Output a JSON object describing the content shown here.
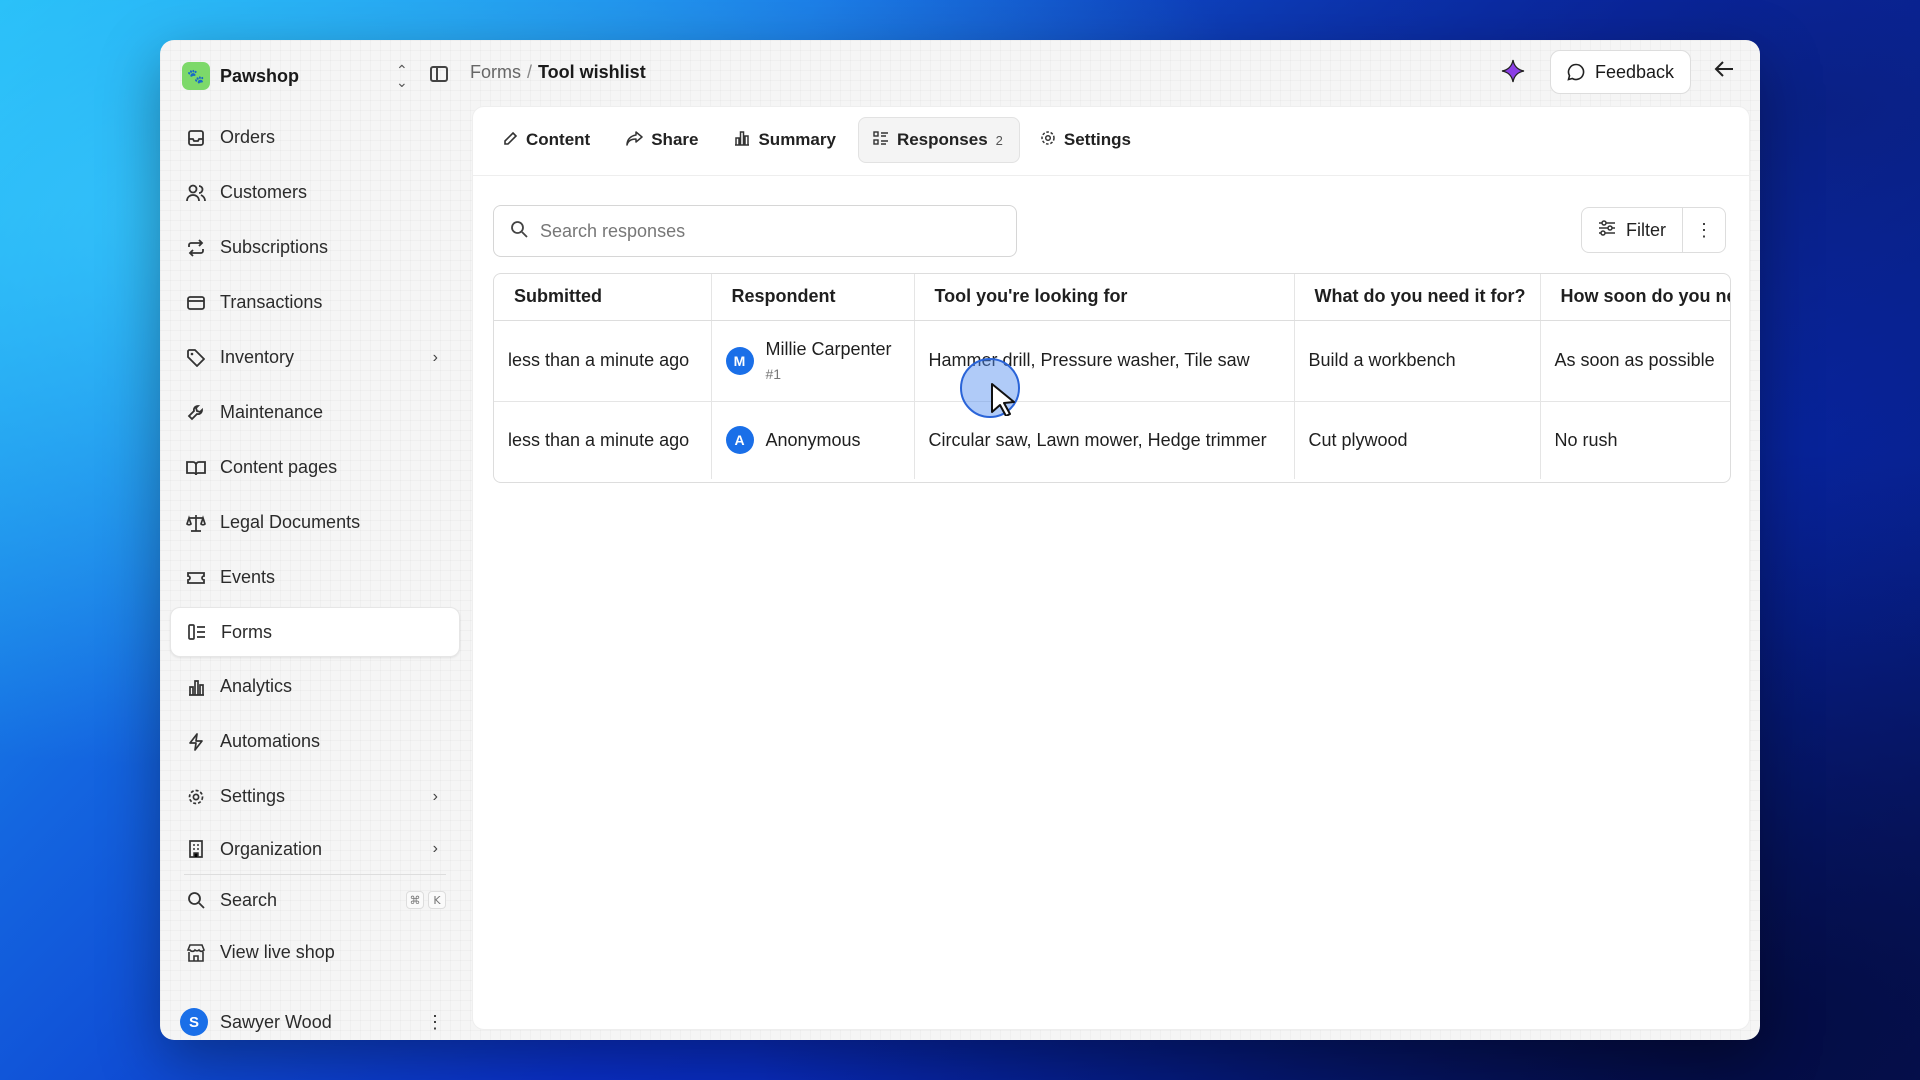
{
  "brand": {
    "name": "Pawshop",
    "logo_color": "#7dd96a"
  },
  "breadcrumb": {
    "parent": "Forms",
    "separator": "/",
    "current": "Tool wishlist"
  },
  "header": {
    "feedback_label": "Feedback"
  },
  "sidebar": {
    "items": [
      {
        "label": "Orders",
        "icon": "inbox-icon"
      },
      {
        "label": "Customers",
        "icon": "users-icon"
      },
      {
        "label": "Subscriptions",
        "icon": "repeat-icon"
      },
      {
        "label": "Transactions",
        "icon": "credit-card-icon"
      },
      {
        "label": "Inventory",
        "icon": "tag-icon",
        "expandable": true
      },
      {
        "label": "Maintenance",
        "icon": "wrench-icon"
      },
      {
        "label": "Content pages",
        "icon": "book-icon"
      },
      {
        "label": "Legal Documents",
        "icon": "scale-icon"
      },
      {
        "label": "Events",
        "icon": "ticket-icon"
      },
      {
        "label": "Forms",
        "icon": "form-icon",
        "active": true
      },
      {
        "label": "Analytics",
        "icon": "bar-chart-icon"
      },
      {
        "label": "Automations",
        "icon": "bolt-icon"
      },
      {
        "label": "Settings",
        "icon": "gear-icon",
        "expandable": true
      },
      {
        "label": "Organization",
        "icon": "building-icon",
        "expandable": true
      }
    ],
    "search": {
      "label": "Search",
      "shortcut": [
        "⌘",
        "K"
      ]
    },
    "view_live": {
      "label": "View live shop"
    },
    "user": {
      "name": "Sawyer Wood",
      "initial": "S"
    }
  },
  "tabs": [
    {
      "label": "Content",
      "icon": "pencil-icon"
    },
    {
      "label": "Share",
      "icon": "share-icon"
    },
    {
      "label": "Summary",
      "icon": "bar-chart-icon"
    },
    {
      "label": "Responses",
      "icon": "list-icon",
      "count": "2",
      "active": true
    },
    {
      "label": "Settings",
      "icon": "gear-icon"
    }
  ],
  "responses": {
    "search_placeholder": "Search responses",
    "filter_label": "Filter",
    "columns": [
      "Submitted",
      "Respondent",
      "Tool you're looking for",
      "What do you need it for?",
      "How soon do you need it?"
    ],
    "rows": [
      {
        "submitted": "less than a minute ago",
        "respondent": "Millie Carpenter",
        "initial": "M",
        "sub": "#1",
        "tool": "Hammer drill, Pressure washer, Tile saw",
        "purpose": "Build a workbench",
        "when": "As soon as possible"
      },
      {
        "submitted": "less than a minute ago",
        "respondent": "Anonymous",
        "initial": "A",
        "sub": "",
        "tool": "Circular saw, Lawn mower, Hedge trimmer",
        "purpose": "Cut plywood",
        "when": "No rush"
      }
    ]
  },
  "colors": {
    "accent": "#1a6fe8",
    "sparkle": "#8b3ee6"
  }
}
